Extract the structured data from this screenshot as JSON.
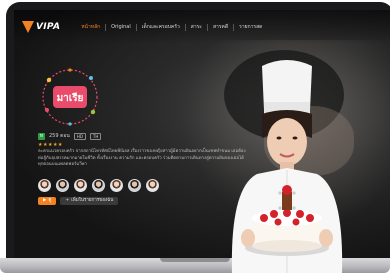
{
  "app": {
    "logo_text": "VIPA",
    "brand_color": "#f58220"
  },
  "nav": {
    "items": [
      {
        "label": "หน้าหลัก",
        "active": true
      },
      {
        "label": "Original",
        "active": false
      },
      {
        "label": "เด็กและครอบครัว",
        "active": false
      },
      {
        "label": "สาระ",
        "active": false
      },
      {
        "label": "สารคดี",
        "active": false
      },
      {
        "label": "รายการสด",
        "active": false
      }
    ]
  },
  "hero": {
    "show_logo_text": "มาเรีย",
    "rating_badge": "ท",
    "meta_text": "259 ตอน",
    "tags": [
      "HD",
      "TH"
    ],
    "stars": "★★★★★",
    "synopsis": "ละครแนวครอบครัว จากสถานีโทรทัศน์ไทยพีบีเอส เรื่องราวของหญิงสาวผู้มีความฝันอยากเป็นเชฟทำขนม เธอต้องต่อสู้กับอุปสรรคมากมายในชีวิต ทั้งเรื่องงาน ความรัก และครอบครัว ร่วมติดตามการเดินทางสู่ความฝันของเธอได้ทุกตอนบนแพลตฟอร์มวีพา",
    "cast_count": 7,
    "play_label": "ดู",
    "play_icon": "play-icon",
    "mylist_label": "เพิ่มในรายการของฉัน",
    "mylist_icon": "plus-icon"
  }
}
